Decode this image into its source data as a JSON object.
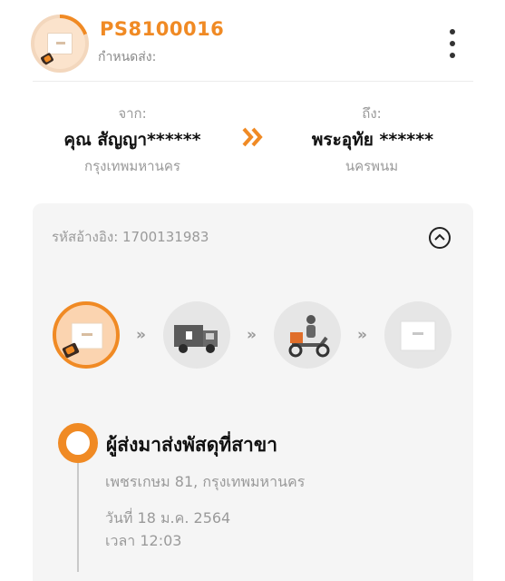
{
  "header": {
    "tracking_number": "PS8100016",
    "due_label": "กำหนดส่ง:"
  },
  "route": {
    "from": {
      "label": "จาก:",
      "name": "คุณ สัญญา******",
      "place": "กรุงเทพมหานคร"
    },
    "to": {
      "label": "ถึง:",
      "name": "พระอุทัย ******",
      "place": "นครพนม"
    }
  },
  "card": {
    "reference": "รหัสอ้างอิง: 1700131983",
    "steps": [
      {
        "icon": "parcel-handover-icon",
        "active": true
      },
      {
        "icon": "delivery-truck-icon",
        "active": false
      },
      {
        "icon": "scooter-rider-icon",
        "active": false
      },
      {
        "icon": "parcel-box-icon",
        "active": false
      }
    ],
    "step_separator": "»",
    "timeline": [
      {
        "title": "ผู้ส่งมาส่งพัสดุที่สาขา",
        "branch": "เพชรเกษม 81, กรุงเทพมหานคร",
        "date": "วันที่ 18 ม.ค. 2564",
        "time": "เวลา 12:03"
      }
    ]
  },
  "colors": {
    "accent": "#f08a24",
    "muted": "#9a9a9a",
    "card_bg": "#f5f5f5"
  }
}
